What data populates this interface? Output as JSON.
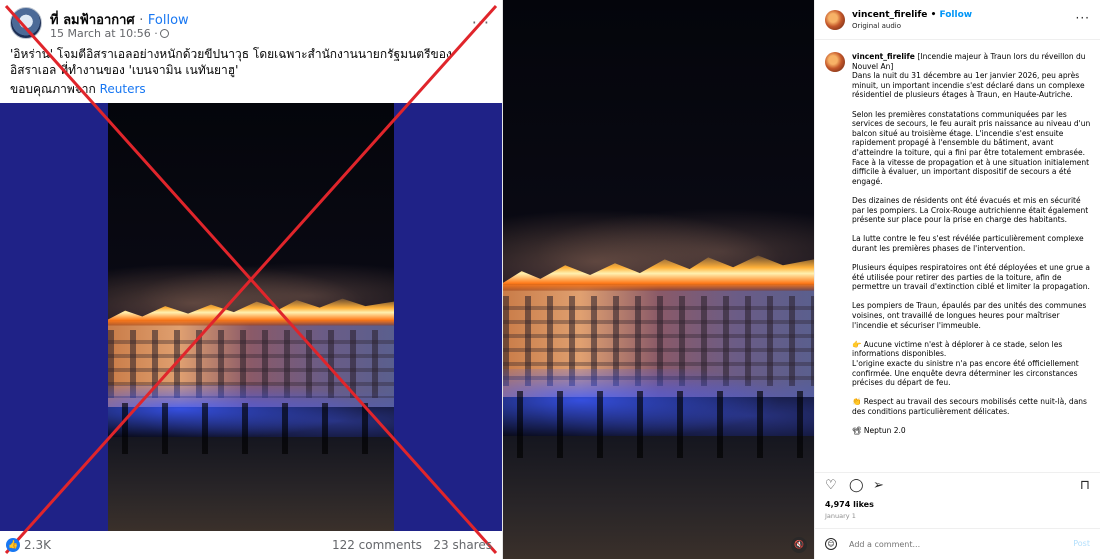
{
  "facebook_post": {
    "page_name": "ที่ ลมฟ้าอากาศ",
    "separator": "·",
    "follow_label": "Follow",
    "timestamp": "15 March at 10:56 ·",
    "more_icon": "more-horizontal-icon",
    "caption": "'อิหร่าน' โจมตีอิสราเอลอย่างหนักด้วยขีปนาวุธ โดยเฉพาะสำนักงานนายกรัฐมนตรีของอิสราเอล ที่ทำงานของ 'เบนจามิน เนทันยาฮู'",
    "credit_prefix": "ขอบคุณภาพจาก",
    "credit_source": "Reuters",
    "reaction_count": "2.3K",
    "comments": "122 comments",
    "shares": "23 shares",
    "overlay_cross_color": "#e0252b"
  },
  "instagram_post": {
    "username": "vincent_firelife",
    "separator": "•",
    "follow_label": "Follow",
    "audio": "Original audio",
    "caption_paragraphs": [
      "[Incendie majeur à Traun lors du réveillon du Nouvel An]\nDans la nuit du 31 décembre au 1er janvier 2026, peu après minuit, un important incendie s'est déclaré dans un complexe résidentiel de plusieurs étages à Traun, en Haute-Autriche.",
      "Selon les premières constatations communiquées par les services de secours, le feu aurait pris naissance au niveau d'un balcon situé au troisième étage. L'incendie s'est ensuite rapidement propagé à l'ensemble du bâtiment, avant d'atteindre la toiture, qui a fini par être totalement embrasée.\nFace à la vitesse de propagation et à une situation initialement difficile à évaluer, un important dispositif de secours a été engagé.",
      "Des dizaines de résidents ont été évacués et mis en sécurité par les pompiers. La Croix-Rouge autrichienne était également présente sur place pour la prise en charge des habitants.",
      "La lutte contre le feu s'est révélée particulièrement complexe durant les premières phases de l'intervention.",
      "Plusieurs équipes respiratoires ont été déployées et une grue a été utilisée pour retirer des parties de la toiture, afin de permettre un travail d'extinction ciblé et limiter la propagation.",
      "Les pompiers de Traun, épaulés par des unités des communes voisines, ont travaillé de longues heures pour maîtriser l'incendie et sécuriser l'immeuble.",
      "👉 Aucune victime n'est à déplorer à ce stade, selon les informations disponibles.\nL'origine exacte du sinistre n'a pas encore été officiellement confirmée. Une enquête devra déterminer les circonstances précises du départ de feu.",
      "👏 Respect au travail des secours mobilisés cette nuit-là, dans des conditions particulièrement délicates.",
      "📽 Neptun 2.0"
    ],
    "likes": "4,974 likes",
    "date": "January 1",
    "comment_placeholder": "Add a comment...",
    "post_label": "Post",
    "icons": [
      "heart-icon",
      "comment-icon",
      "share-icon",
      "bookmark-icon",
      "emoji-icon",
      "mute-icon"
    ],
    "accent_color": "#0095f6"
  }
}
